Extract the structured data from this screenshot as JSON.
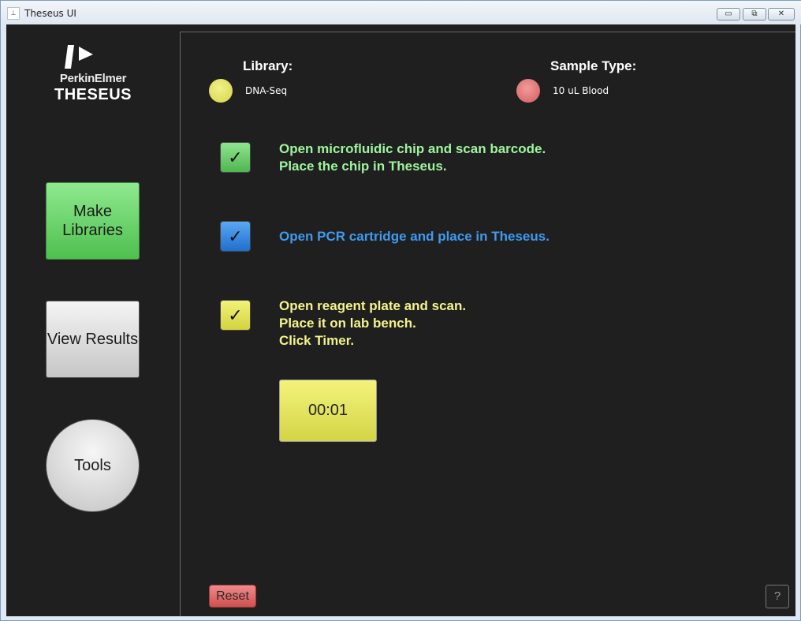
{
  "window": {
    "title": "Theseus UI",
    "icon": "app-icon",
    "controls": {
      "minimize": "▭",
      "maximize": "⧉",
      "close": "✕"
    }
  },
  "sidebar": {
    "logo": {
      "brand": "PerkinElmer",
      "product": "THESEUS"
    },
    "buttons": {
      "make_libraries": "Make Libraries",
      "view_results": "View Results",
      "tools": "Tools"
    }
  },
  "header": {
    "library_label": "Library:",
    "library_value": "DNA-Seq",
    "sample_label": "Sample Type:",
    "sample_value": "10 uL Blood"
  },
  "steps": [
    {
      "check": "✓",
      "line1": "Open microfluidic chip and scan barcode.",
      "line2": "Place the chip in Theseus.",
      "line3": "",
      "color": "#9ef59e"
    },
    {
      "check": "✓",
      "line1": "Open PCR cartridge and place in Theseus.",
      "line2": "",
      "line3": "",
      "color": "#3d9bf0"
    },
    {
      "check": "✓",
      "line1": "Open reagent plate and scan.",
      "line2": "Place it on lab bench.",
      "line3": "Click Timer.",
      "color": "#f4f48a"
    }
  ],
  "timer": {
    "value": "00:01"
  },
  "footer": {
    "reset_label": "Reset",
    "help_label": "?"
  },
  "colors": {
    "background": "#1f1f1f",
    "accent_green": "#4fbf4f",
    "accent_blue": "#1f6fd0",
    "accent_yellow": "#d4d446",
    "accent_red": "#d05050"
  }
}
